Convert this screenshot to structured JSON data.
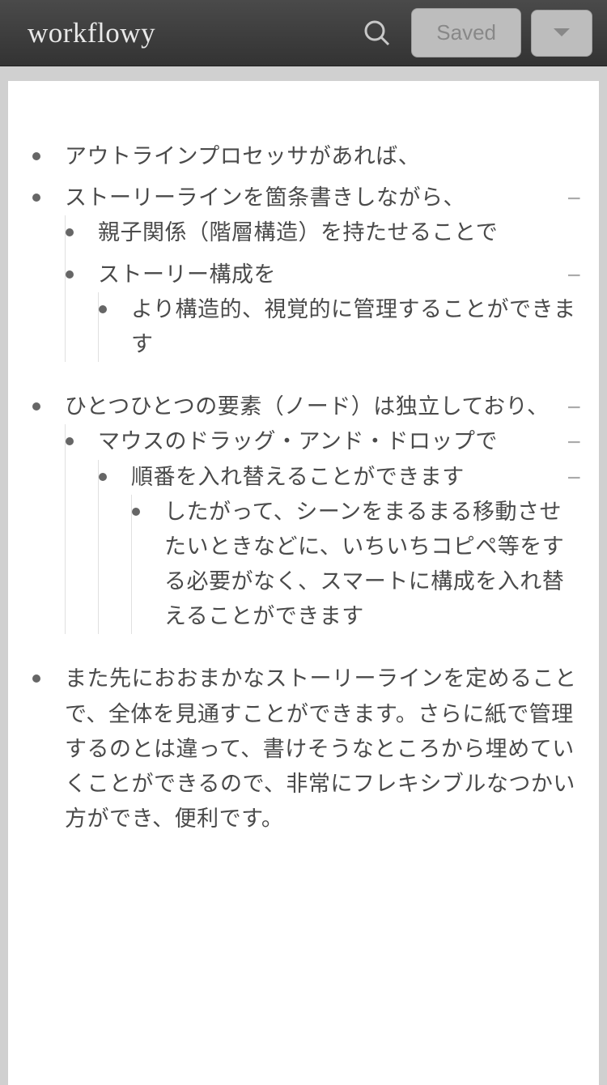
{
  "header": {
    "logo": "workflowy",
    "saved_label": "Saved"
  },
  "outline": [
    {
      "text": "アウトラインプロセッサがあれば、",
      "collapse": false,
      "children": []
    },
    {
      "text": "ストーリーラインを箇条書きしながら、",
      "collapse": true,
      "children": [
        {
          "text": "親子関係（階層構造）を持たせることで",
          "collapse": false,
          "children": []
        },
        {
          "text": "ストーリー構成を",
          "collapse": true,
          "children": [
            {
              "text": "より構造的、視覚的に管理することができます",
              "collapse": false,
              "children": []
            }
          ]
        }
      ]
    },
    {
      "text": "ひとつひとつの要素（ノード）は独立しており、",
      "collapse": true,
      "children": [
        {
          "text": "マウスのドラッグ・アンド・ドロップで",
          "collapse": true,
          "children": [
            {
              "text": "順番を入れ替えることができます",
              "collapse": true,
              "children": [
                {
                  "text": "したがって、シーンをまるまる移動させたいときなどに、いちいちコピペ等をする必要がなく、スマートに構成を入れ替えることができます",
                  "collapse": false,
                  "children": []
                }
              ]
            }
          ]
        }
      ]
    },
    {
      "text": "また先におおまかなストーリーラインを定めることで、全体を見通すことができます。さらに紙で管理するのとは違って、書けそうなところから埋めていくことができるので、非常にフレキシブルなつかい方ができ、便利です。",
      "collapse": false,
      "children": []
    }
  ]
}
